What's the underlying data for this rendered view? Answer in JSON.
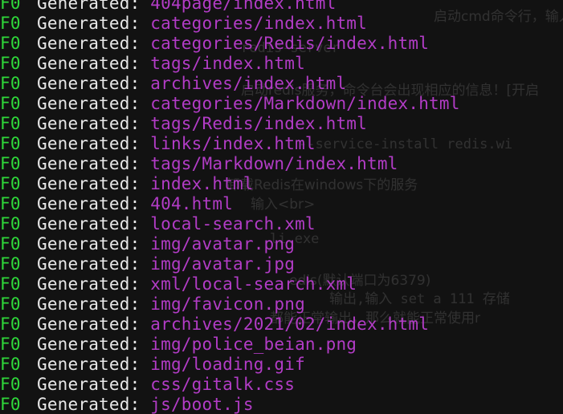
{
  "colors": {
    "background": "#121212",
    "status": "#2fd83a",
    "label": "#e8e8e8",
    "path": "#b23cc6"
  },
  "log": [
    {
      "code": "F0",
      "label": "Generated:",
      "path": "404page/index.html"
    },
    {
      "code": "F0",
      "label": "Generated:",
      "path": "categories/index.html"
    },
    {
      "code": "F0",
      "label": "Generated:",
      "path": "categories/Redis/index.html"
    },
    {
      "code": "F0",
      "label": "Generated:",
      "path": "tags/index.html"
    },
    {
      "code": "F0",
      "label": "Generated:",
      "path": "archives/index.html"
    },
    {
      "code": "F0",
      "label": "Generated:",
      "path": "categories/Markdown/index.html"
    },
    {
      "code": "F0",
      "label": "Generated:",
      "path": "tags/Redis/index.html"
    },
    {
      "code": "F0",
      "label": "Generated:",
      "path": "links/index.html"
    },
    {
      "code": "F0",
      "label": "Generated:",
      "path": "tags/Markdown/index.html"
    },
    {
      "code": "F0",
      "label": "Generated:",
      "path": "index.html"
    },
    {
      "code": "F0",
      "label": "Generated:",
      "path": "404.html"
    },
    {
      "code": "F0",
      "label": "Generated:",
      "path": "local-search.xml"
    },
    {
      "code": "F0",
      "label": "Generated:",
      "path": "img/avatar.png"
    },
    {
      "code": "F0",
      "label": "Generated:",
      "path": "img/avatar.jpg"
    },
    {
      "code": "F0",
      "label": "Generated:",
      "path": "xml/local-search.xml"
    },
    {
      "code": "F0",
      "label": "Generated:",
      "path": "img/favicon.png"
    },
    {
      "code": "F0",
      "label": "Generated:",
      "path": "archives/2021/02/index.html"
    },
    {
      "code": "F0",
      "label": "Generated:",
      "path": "img/police_beian.png"
    },
    {
      "code": "F0",
      "label": "Generated:",
      "path": "img/loading.gif"
    },
    {
      "code": "F0",
      "label": "Generated:",
      "path": "css/gitalk.css"
    },
    {
      "code": "F0",
      "label": "Generated:",
      "path": "js/boot.js"
    }
  ],
  "background_text": {
    "line1": "启动cmd命令行，输入",
    "line2": "redis-server",
    "line3": "启动redis服务，命令台会出现相应的信息！[开启",
    "line4": "--service-install redis.wi",
    "line5": "卸载Redis在windows下的服务",
    "line6": "输入<br>",
    "line7": "li.exe",
    "line8": "edis(默认端口为6379)",
    "line9": "输出,输入 set a 111 存储",
    "line10": "都能正常输出，那么就能正常使用r"
  }
}
